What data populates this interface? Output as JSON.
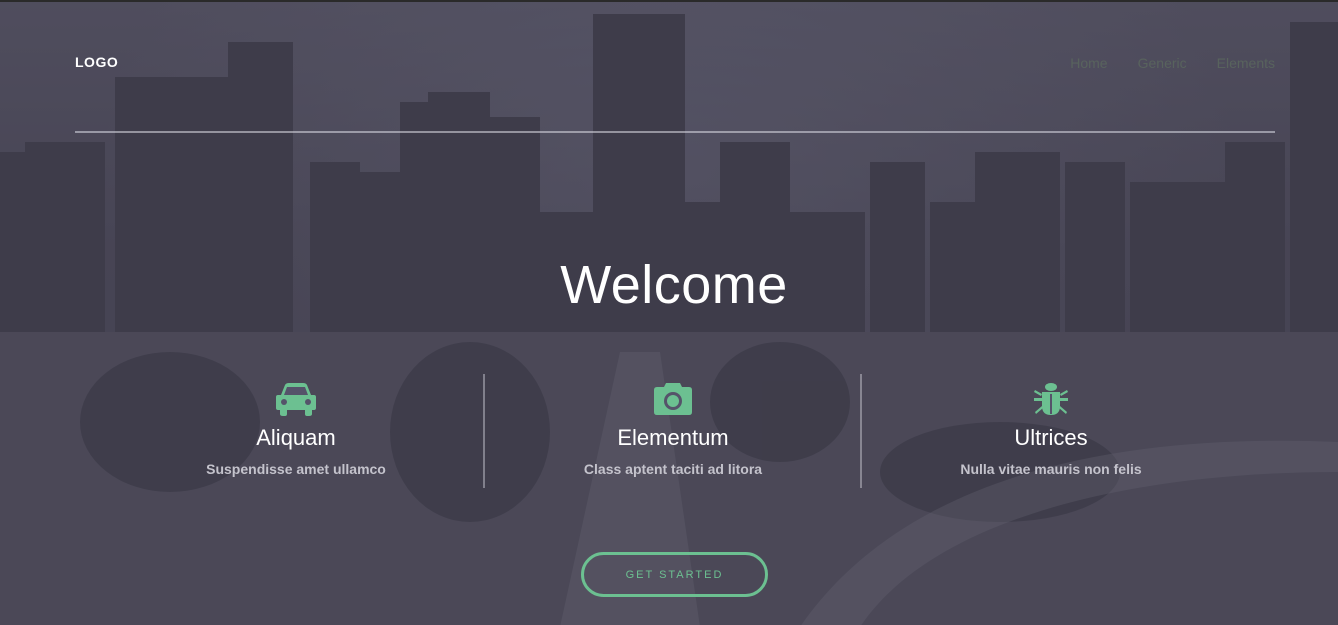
{
  "header": {
    "logo": "LOGO",
    "nav": [
      "Home",
      "Generic",
      "Elements"
    ]
  },
  "hero": {
    "title": "Welcome",
    "features": [
      {
        "icon": "car-icon",
        "title": "Aliquam",
        "subtitle": "Suspendisse amet ullamco"
      },
      {
        "icon": "camera-icon",
        "title": "Elementum",
        "subtitle": "Class aptent taciti ad litora"
      },
      {
        "icon": "bug-icon",
        "title": "Ultrices",
        "subtitle": "Nulla vitae mauris non felis"
      }
    ],
    "cta_label": "GET STARTED"
  },
  "colors": {
    "accent": "#6cc091",
    "overlay": "#4d4b5a",
    "text": "#ffffff"
  }
}
